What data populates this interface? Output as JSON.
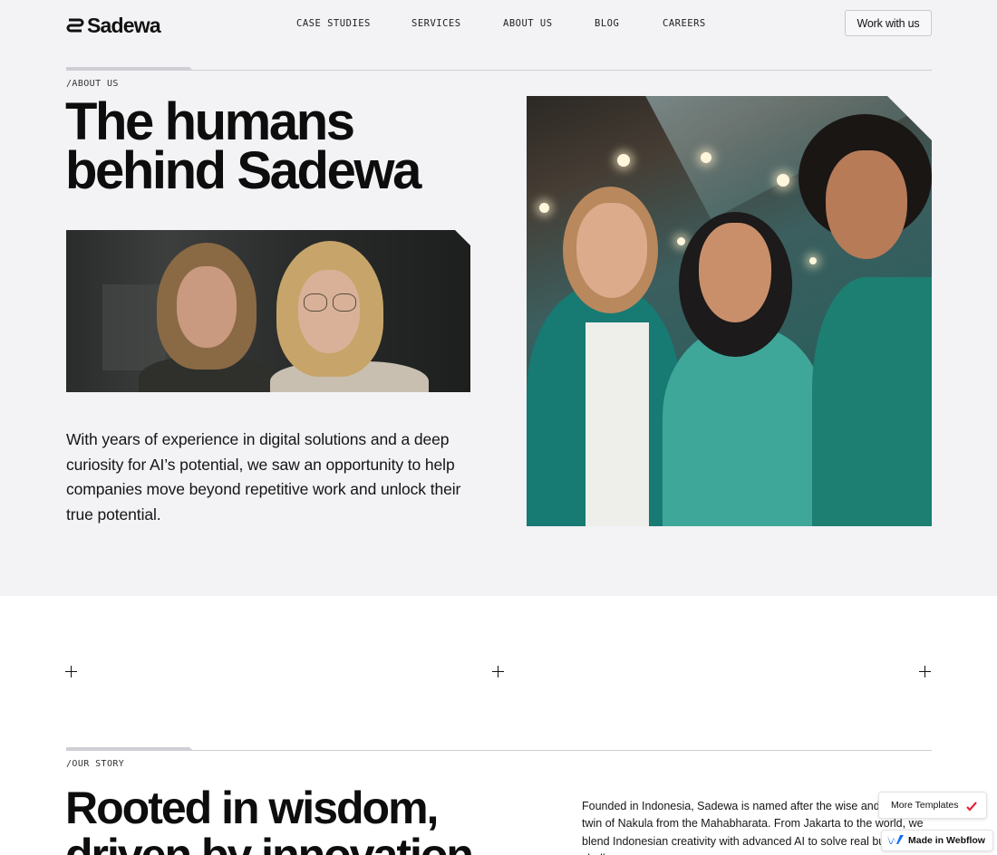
{
  "brand": {
    "name": "Sadewa",
    "logo_icon": "sadewa-logo-icon"
  },
  "nav": {
    "items": [
      {
        "label": "CASE STUDIES"
      },
      {
        "label": "SERVICES"
      },
      {
        "label": "ABOUT US"
      },
      {
        "label": "BLOG"
      },
      {
        "label": "CAREERS"
      }
    ],
    "cta_label": "Work with us"
  },
  "hero": {
    "eyebrow": "/ABOUT US",
    "title_line1": "The humans",
    "title_line2": "behind Sadewa",
    "paragraph": "With years of experience in digital solutions and a deep curiosity for AI’s potential, we saw an opportunity to help companies move beyond repetitive work and unlock their true potential."
  },
  "story": {
    "eyebrow": "/OUR STORY",
    "title_line1": "Rooted in wisdom,",
    "title_line2": "driven by innovation",
    "paragraph": "Founded in Indonesia, Sadewa is named after the wise and skilled twin of Nakula from the Mahabharata. From Jakarta to the world, we blend Indonesian creativity with advanced AI to solve real business challenges."
  },
  "badges": {
    "more_templates": "More Templates",
    "made_in_webflow": "Made in Webflow"
  },
  "colors": {
    "hero_background": "#f3f2f5",
    "page_background": "#ffffff",
    "text": "#111111",
    "divider": "#cfced4"
  }
}
